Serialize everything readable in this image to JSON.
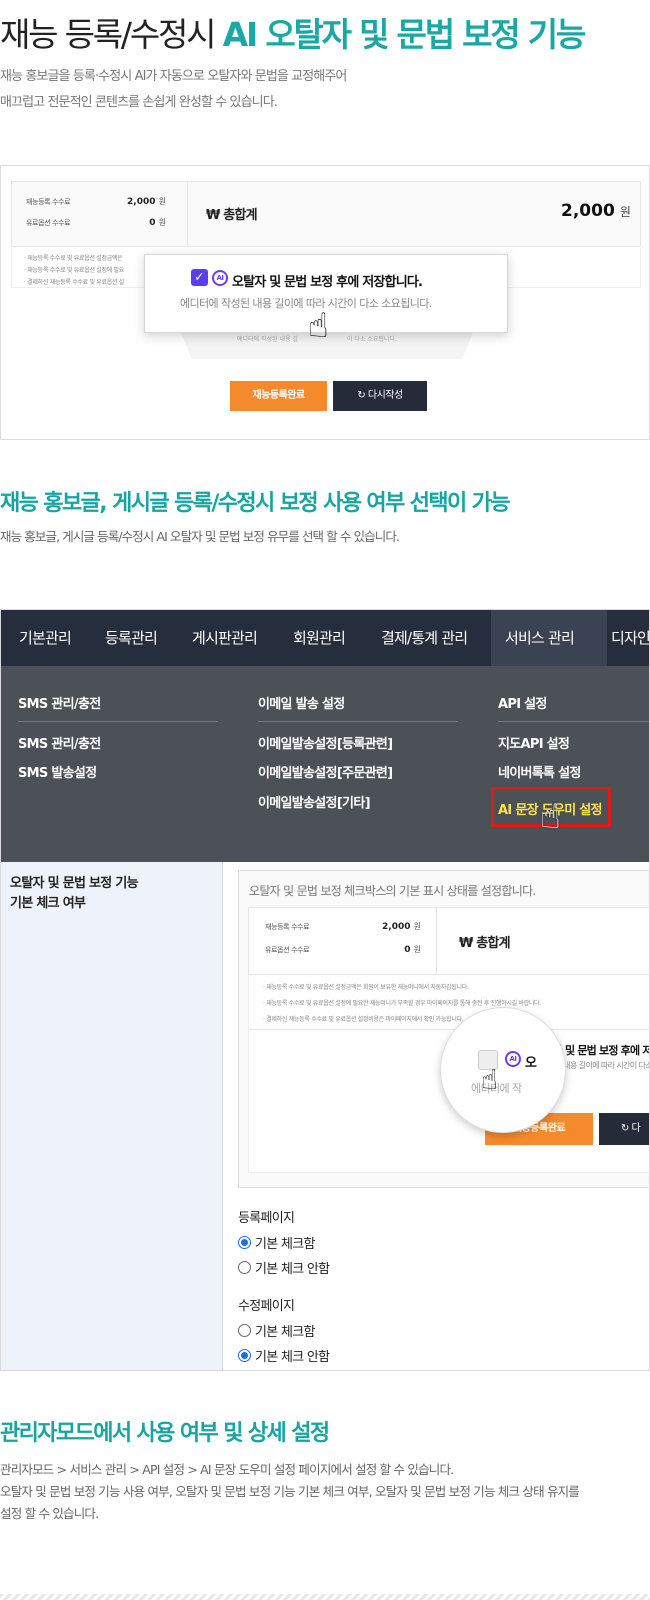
{
  "section1": {
    "title_plain": "재능 등록/수정시 ",
    "title_accent": "AI 오탈자 및 문법 보정  기능",
    "desc_line1": "재능 홍보글을 등록·수정시 AI가 자동으로 오탈자와 문법을 교정해주어",
    "desc_line2": "매끄럽고 전문적인 콘텐츠를 손쉽게 완성할 수 있습니다."
  },
  "shot1": {
    "fee_label": "재능등록 수수료",
    "fee_value": "2,000",
    "option_label": "유료옵션 수수료",
    "option_value": "0",
    "won": "원",
    "total_label": "₩ 총합계",
    "total_value": "2,000",
    "note1": "· 재능등록 수수료 및 유료옵션 설정금액은",
    "note2": "· 재능등록 수수료 및 유료옵션 설정에 필요",
    "note3": "· 결제하신 재능등록 수수료 및 유료옵션 설",
    "under_note_a": "에디터에 작성된 내용 길",
    "under_note_b": "이 다소 소요됩니다.",
    "popup_title": "오탈자 및 문법 보정 후에 저장합니다.",
    "popup_sub": "에디터에 작성된 내용 길이에 따라 시간이 다소 소요됩니다.",
    "check_mark": "✓",
    "ai_badge": "AI",
    "btn_complete": "재능등록완료",
    "btn_rewrite": "↻ 다시작성"
  },
  "section2": {
    "title": "재능 홍보글, 게시글 등록/수정시  보정 사용 여부 선택이 가능",
    "desc": "재능 홍보글, 게시글 등록/수정시 AI 오탈자 및 문법 보정 유무를 선택 할 수 있습니다."
  },
  "admin": {
    "nav": [
      "기본관리",
      "등록관리",
      "게시판관리",
      "회원관리",
      "결제/통계 관리",
      "서비스 관리",
      "디자인"
    ],
    "menu_col1_head": "SMS 관리/충전",
    "menu_col1": [
      "SMS 관리/충전",
      "SMS 발송설정"
    ],
    "menu_col2_head": "이메일 발송 설정",
    "menu_col2": [
      "이메일발송설정[등록관련]",
      "이메일발송설정[주문관련]",
      "이메일발송설정[기타]"
    ],
    "menu_col3_head": "API 설정",
    "menu_col3": [
      "지도API 설정",
      "네이버톡톡 설정",
      "AI 문장 도우미 설정"
    ],
    "left_title_line1": "오탈자 및 문법 보정 기능",
    "left_title_line2": "기본 체크 여부",
    "inner_desc": "오탈자 및 문법 보정 체크박스의 기본 표시 상태를 설정합니다.",
    "fee_label": "재능등록 수수료",
    "fee_value": "2,000",
    "option_label": "유료옵션 수수료",
    "option_value": "0",
    "won": "원",
    "total_label": "₩ 총합계",
    "note1": "· 재능등록 수수료 및 유료옵션 설정금액은 회원이 보유한 재능머니에서 자동차감됩니다.",
    "note2": "· 재능등록 수수료 및 유료옵션 설정에 필요한 재능머니가 부족할 경우 마이페이지를 통해 충전 후 진행하시길 바랍니다.",
    "note3": "· 결제하신 재능등록 수수료 및 유료옵션 설정비용은 마이페이지에서 확인 가능합니다.",
    "inner_popup_title": "오탈자 및 문법 보정 후에 저장",
    "inner_popup_sub": "작성된 내용 길이에 따라 시간이 다소",
    "zoom_fragment": "에디터에 작",
    "btn_complete": "재능등록완료",
    "btn_rewrite": "↻ 다",
    "group1_title": "등록페이지",
    "group1_options": [
      "기본 체크함",
      "기본 체크 안함"
    ],
    "group1_selected": 0,
    "group2_title": "수정페이지",
    "group2_options": [
      "기본 체크함",
      "기본 체크 안함"
    ],
    "group2_selected": 1
  },
  "section3": {
    "title": "관리자모드에서 사용 여부 및 상세 설정",
    "line1": "관리자모드 > 서비스 관리 > API 설정 > AI 문장 도우미 설정 페이지에서 설정 할 수 있습니다.",
    "line2": "오탈자 및 문법 보정 기능 사용 여부, 오탈자 및 문법 보정 기능 기본 체크 여부,  오탈자 및 문법 보정 기능 체크 상태 유지를",
    "line3": "설정 할 수 있습니다."
  },
  "colors": {
    "accent_teal": "#1aa7a6",
    "nav_dark": "#262e3d",
    "button_orange": "#f58a2c",
    "highlight_red": "#e01818",
    "check_purple": "#5a3ff0"
  }
}
